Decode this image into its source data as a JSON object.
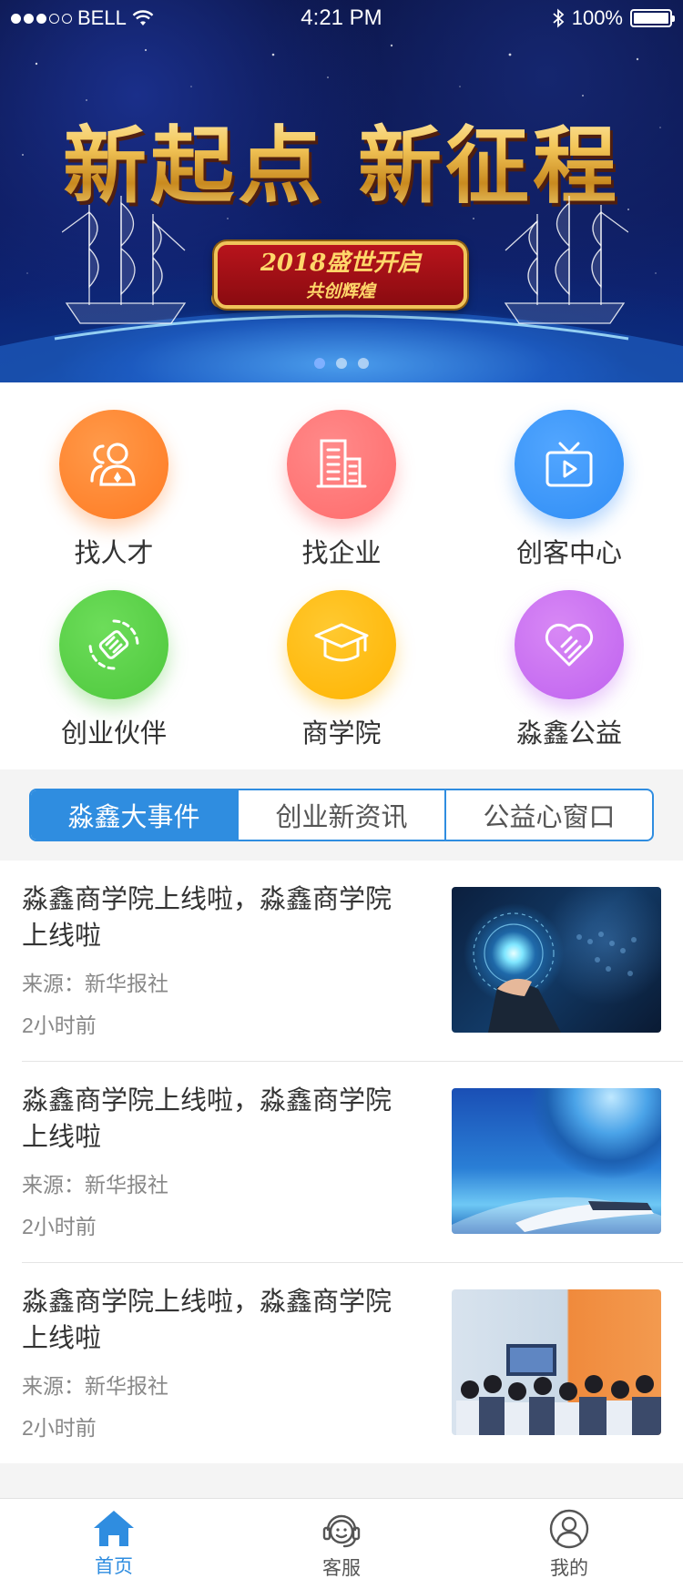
{
  "status_bar": {
    "carrier": "BELL",
    "time": "4:21 PM",
    "battery": "100%"
  },
  "banner": {
    "headline": "新起点 新征程",
    "plaque_line1": "2018盛世开启",
    "plaque_line2": "共创辉煌",
    "slide_count": 3,
    "active_slide": 1
  },
  "categories": [
    {
      "label": "找人才",
      "icon": "people-icon",
      "color": "#ff7a22"
    },
    {
      "label": "找企业",
      "icon": "building-icon",
      "color": "#ff6b6b"
    },
    {
      "label": "创客中心",
      "icon": "tv-icon",
      "color": "#2f8df5"
    },
    {
      "label": "创业伙伴",
      "icon": "handshake-icon",
      "color": "#4dc73c"
    },
    {
      "label": "商学院",
      "icon": "graduation-cap-icon",
      "color": "#ffb300"
    },
    {
      "label": "淼鑫公益",
      "icon": "heart-hands-icon",
      "color": "#bf62ef"
    }
  ],
  "tabs": [
    {
      "label": "淼鑫大事件",
      "active": true
    },
    {
      "label": "创业新资讯",
      "active": false
    },
    {
      "label": "公益心窗口",
      "active": false
    }
  ],
  "news": [
    {
      "title": "淼鑫商学院上线啦，淼鑫商学院上线啦",
      "source": "来源：新华报社",
      "time": "2小时前",
      "thumb": "tech-hand-image"
    },
    {
      "title": "淼鑫商学院上线啦，淼鑫商学院上线啦",
      "source": "来源：新华报社",
      "time": "2小时前",
      "thumb": "earth-train-image"
    },
    {
      "title": "淼鑫商学院上线啦，淼鑫商学院上线啦",
      "source": "来源：新华报社",
      "time": "2小时前",
      "thumb": "classroom-image"
    }
  ],
  "bottom_nav": [
    {
      "label": "首页",
      "icon": "home-icon",
      "active": true
    },
    {
      "label": "客服",
      "icon": "customer-service-icon",
      "active": false
    },
    {
      "label": "我的",
      "icon": "profile-icon",
      "active": false
    }
  ],
  "colors": {
    "accent": "#2f8de0",
    "headline_gold": "#f3c659"
  }
}
